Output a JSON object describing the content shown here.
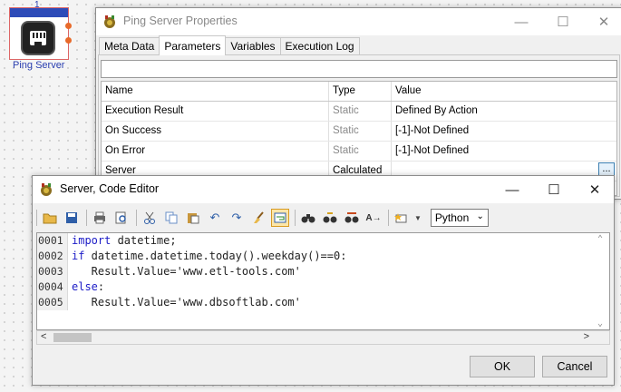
{
  "canvas": {
    "node_number": "1",
    "node_label": "Ping Server"
  },
  "properties_window": {
    "title": "Ping Server Properties",
    "tabs": [
      "Meta Data",
      "Parameters",
      "Variables",
      "Execution Log"
    ],
    "active_tab": "Parameters",
    "grid": {
      "columns": [
        "Name",
        "Type",
        "Value"
      ],
      "rows": [
        {
          "name": "Execution Result",
          "type": "Static",
          "value": "Defined By Action"
        },
        {
          "name": "On Success",
          "type": "Static",
          "value": "[-1]-Not Defined"
        },
        {
          "name": "On Error",
          "type": "Static",
          "value": "[-1]-Not Defined"
        },
        {
          "name": "Server",
          "type": "Calculated",
          "value": "",
          "button": "..."
        }
      ]
    }
  },
  "editor_window": {
    "title": "Server, Code Editor",
    "language": "Python",
    "code_lines": [
      {
        "no": "0001",
        "parts": [
          {
            "t": "import",
            "kw": true
          },
          {
            "t": " datetime;",
            "kw": false
          }
        ]
      },
      {
        "no": "0002",
        "parts": [
          {
            "t": "if",
            "kw": true
          },
          {
            "t": " datetime.datetime.today().weekday()==0:",
            "kw": false
          }
        ]
      },
      {
        "no": "0003",
        "parts": [
          {
            "t": "   Result.Value='www.etl-tools.com'",
            "kw": false
          }
        ]
      },
      {
        "no": "0004",
        "parts": [
          {
            "t": "else",
            "kw": true
          },
          {
            "t": ":",
            "kw": false
          }
        ]
      },
      {
        "no": "0005",
        "parts": [
          {
            "t": "   Result.Value='www.dbsoftlab.com'",
            "kw": false
          }
        ]
      }
    ],
    "ok_label": "OK",
    "cancel_label": "Cancel"
  },
  "colors": {
    "keyword": "#1c1cc7",
    "node_bar": "#2d4bb8",
    "node_label": "#2a3fb0"
  }
}
